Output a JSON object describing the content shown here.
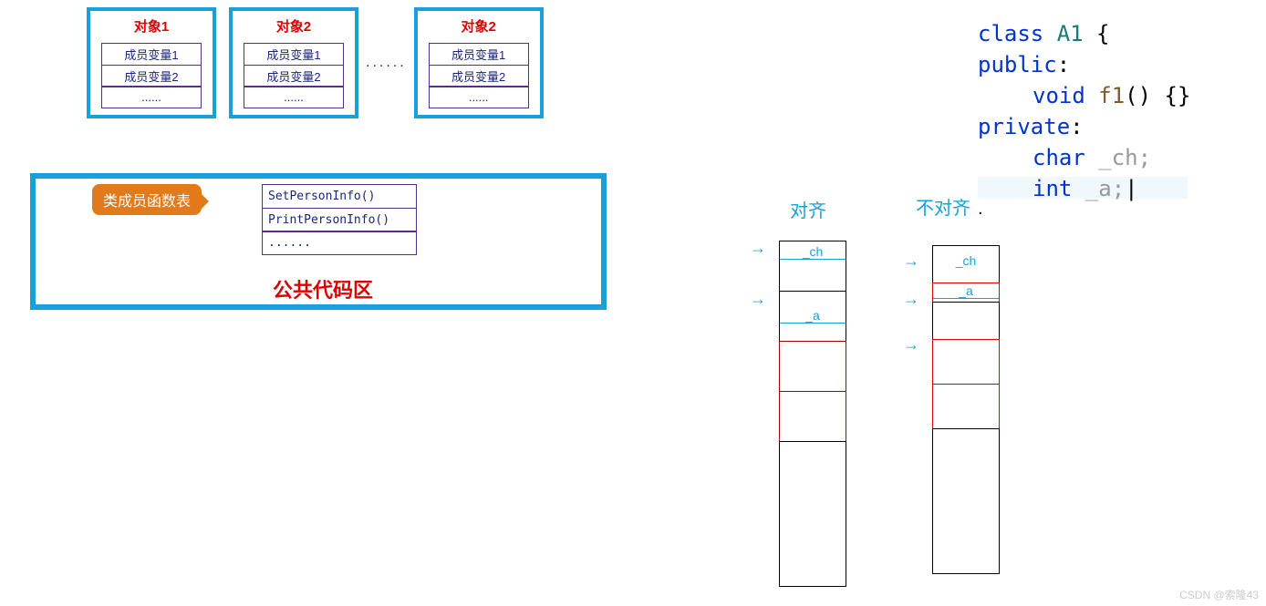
{
  "objects": {
    "titles": [
      "对象1",
      "对象2",
      "对象2"
    ],
    "slot1": "成员变量1",
    "slot2": "成员变量2",
    "slot3": "......",
    "mid_ellipsis": "......"
  },
  "pub": {
    "bubble": "类成员函数表",
    "funcs": [
      "SetPersonInfo()",
      "PrintPersonInfo()",
      "......"
    ],
    "label": "公共代码区"
  },
  "code": {
    "l1a": "class",
    "l1b": " A1 ",
    "l1c": "{",
    "l2a": "public",
    "l2b": ":",
    "l3a": "void",
    "l3b": " f1",
    "l3c": "() {}",
    "l4a": "private",
    "l4b": ":",
    "l5a": "char",
    "l5b": " _ch;",
    "l6a": "int",
    "l6b": " _a;",
    "cursor": "|"
  },
  "mem": {
    "aligned": "对齐",
    "unaligned": "不对齐",
    "ch": "_ch",
    "a": "_a",
    "dot": "."
  },
  "watermark": "CSDN @索隆43"
}
